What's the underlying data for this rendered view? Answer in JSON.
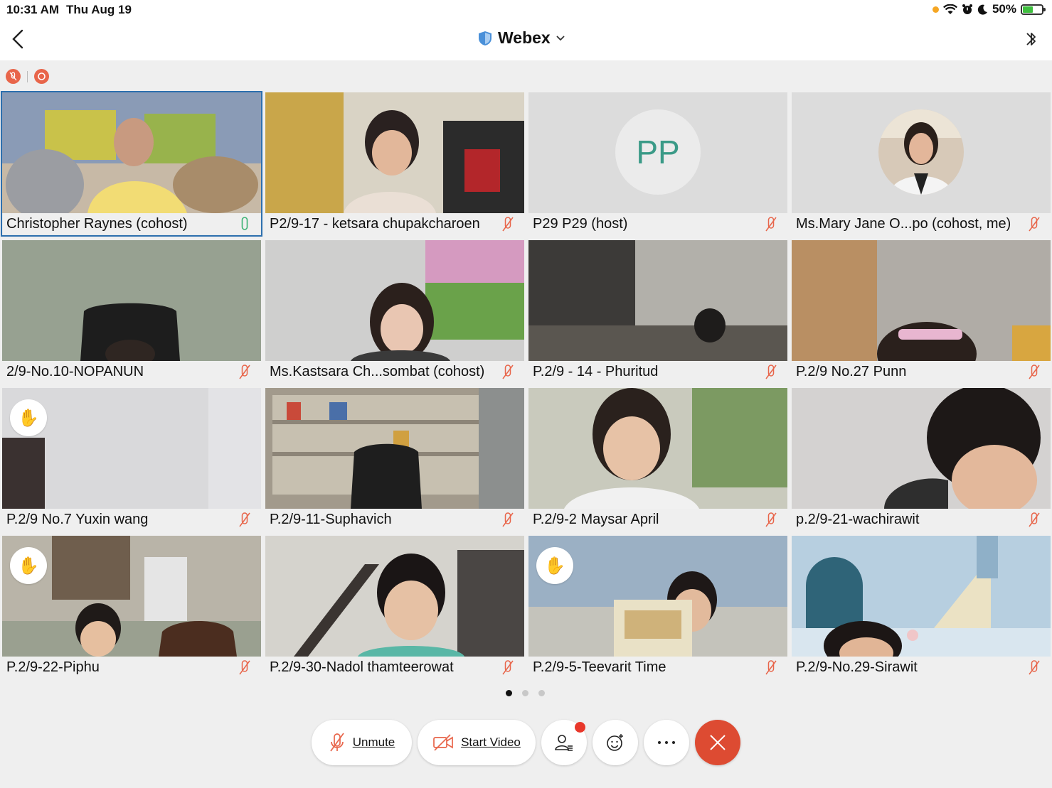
{
  "status_bar": {
    "time": "10:31 AM",
    "date": "Thu Aug 19",
    "battery": "50%"
  },
  "nav": {
    "title": "Webex"
  },
  "participants": [
    {
      "name": "Christopher Raynes (cohost)",
      "mic": "on",
      "active": true
    },
    {
      "name": "P2/9-17 - ketsara chupakcharoen",
      "mic": "muted"
    },
    {
      "name": "P29 P29 (host)",
      "mic": "muted",
      "initials": "PP"
    },
    {
      "name": "Ms.Mary Jane O...po (cohost, me)",
      "mic": "muted",
      "avatar": true
    },
    {
      "name": "2/9-No.10-NOPANUN",
      "mic": "muted"
    },
    {
      "name": "Ms.Kastsara Ch...sombat (cohost)",
      "mic": "muted"
    },
    {
      "name": "P.2/9 - 14 - Phuritud",
      "mic": "muted"
    },
    {
      "name": "P.2/9 No.27 Punn",
      "mic": "muted"
    },
    {
      "name": "P.2/9 No.7 Yuxin wang",
      "mic": "muted",
      "hand_raised": true
    },
    {
      "name": "P.2/9-11-Suphavich",
      "mic": "muted"
    },
    {
      "name": "P.2/9-2 Maysar April",
      "mic": "muted"
    },
    {
      "name": "p.2/9-21-wachirawit",
      "mic": "muted"
    },
    {
      "name": "P.2/9-22-Piphu",
      "mic": "muted",
      "hand_raised": true
    },
    {
      "name": "P.2/9-30-Nadol thamteerowat",
      "mic": "muted"
    },
    {
      "name": "P.2/9-5-Teevarit Time",
      "mic": "muted",
      "hand_raised": true
    },
    {
      "name": "P.2/9-No.29-Sirawit",
      "mic": "muted"
    }
  ],
  "controls": {
    "unmute": "Unmute",
    "start_video": "Start Video"
  },
  "colors": {
    "leave": "#dd4b32",
    "mute_red": "#e8654a",
    "accent_blue": "#2d6fae",
    "initials_green": "#3a9a87"
  },
  "pagination": {
    "pages": 3,
    "current": 1
  }
}
